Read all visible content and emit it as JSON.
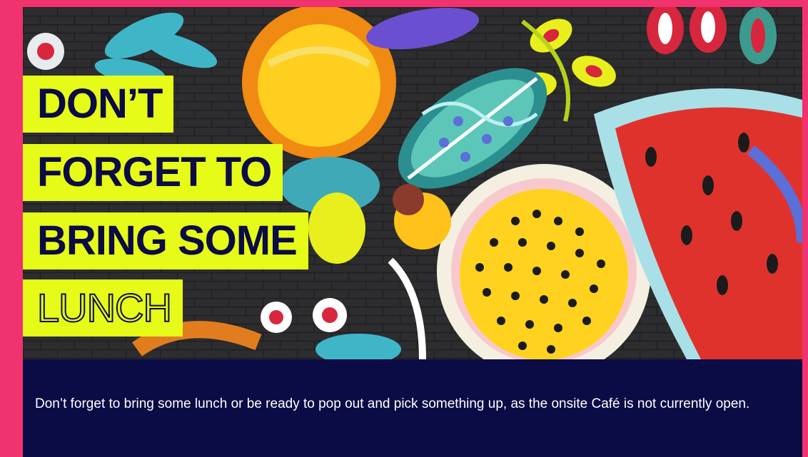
{
  "headline": {
    "line1": "DON’T",
    "line2": "FORGET TO",
    "line3": "BRING SOME",
    "line4": "LUNCH"
  },
  "body": {
    "text": "Don’t forget to bring some lunch or be ready to pop out and pick something up, as the onsite Café is not currently open."
  },
  "colors": {
    "page_background": "#f0326e",
    "headline_highlight": "#e6fb18",
    "navy": "#0b0b45",
    "body_text": "#ffffff"
  },
  "image": {
    "subject": "colorful fruit mural painted on brick wall"
  }
}
